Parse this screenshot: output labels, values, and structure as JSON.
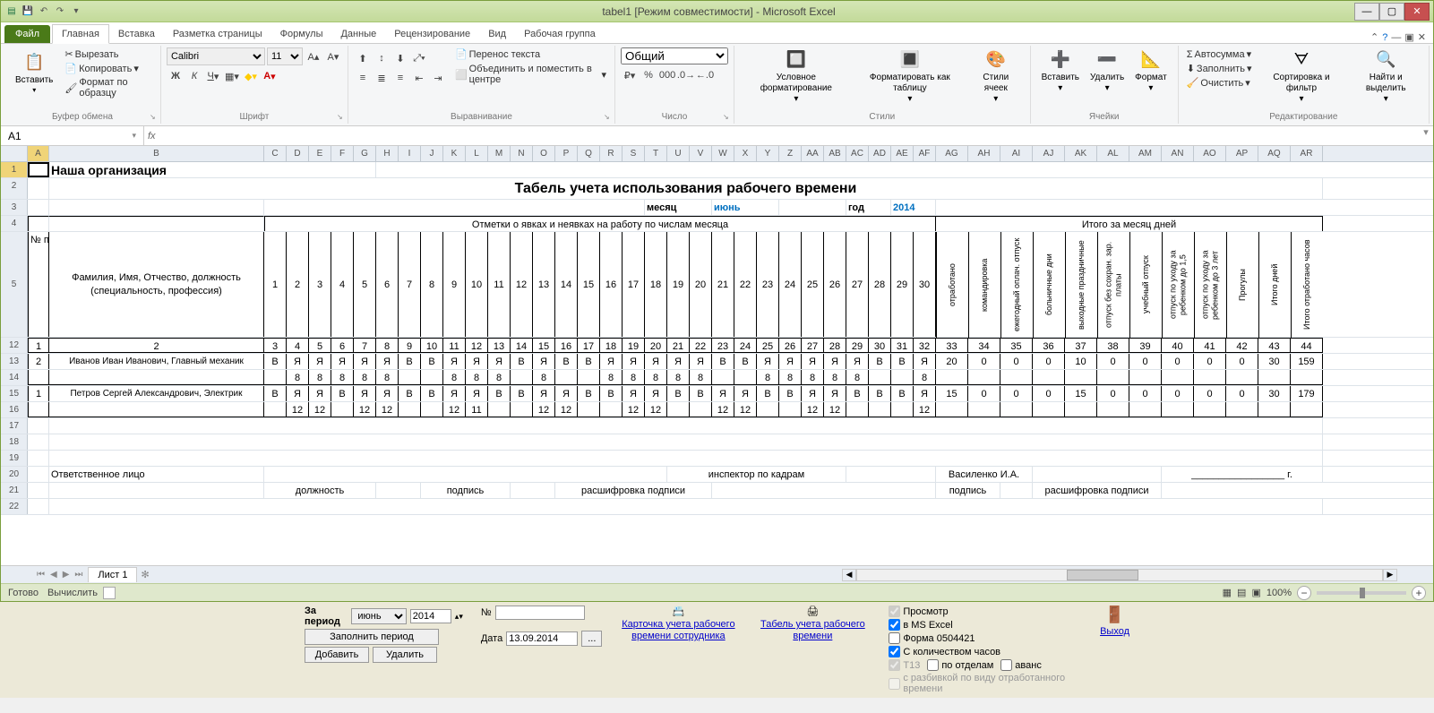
{
  "app": {
    "title": "tabel1 [Режим совместимости] - Microsoft Excel"
  },
  "ribbon": {
    "file": "Файл",
    "tabs": [
      "Главная",
      "Вставка",
      "Разметка страницы",
      "Формулы",
      "Данные",
      "Рецензирование",
      "Вид",
      "Рабочая группа"
    ],
    "active_tab": "Главная",
    "clipboard": {
      "paste": "Вставить",
      "cut": "Вырезать",
      "copy": "Копировать",
      "format": "Формат по образцу",
      "label": "Буфер обмена"
    },
    "font": {
      "name": "Calibri",
      "size": "11",
      "label": "Шрифт"
    },
    "align": {
      "wrap": "Перенос текста",
      "merge": "Объединить и поместить в центре",
      "label": "Выравнивание"
    },
    "number": {
      "format": "Общий",
      "label": "Число"
    },
    "styles": {
      "cond": "Условное форматирование",
      "table": "Форматировать как таблицу",
      "cell": "Стили ячеек",
      "label": "Стили"
    },
    "cells": {
      "insert": "Вставить",
      "delete": "Удалить",
      "format": "Формат",
      "label": "Ячейки"
    },
    "editing": {
      "autosum": "Автосумма",
      "fill": "Заполнить",
      "clear": "Очистить",
      "sort": "Сортировка и фильтр",
      "find": "Найти и выделить",
      "label": "Редактирование"
    }
  },
  "namebox": {
    "ref": "A1"
  },
  "status": {
    "ready": "Готово",
    "calc": "Вычислить",
    "zoom": "100%"
  },
  "sheet": {
    "tabname": "Лист 1",
    "cols": [
      "A",
      "B",
      "C",
      "D",
      "E",
      "F",
      "G",
      "H",
      "I",
      "J",
      "K",
      "L",
      "M",
      "N",
      "O",
      "P",
      "Q",
      "R",
      "S",
      "T",
      "U",
      "V",
      "W",
      "X",
      "Y",
      "Z",
      "AA",
      "AB",
      "AC",
      "AD",
      "AE",
      "AF",
      "AG",
      "AH",
      "AI",
      "AJ",
      "AK",
      "AL",
      "AM",
      "AN",
      "AO",
      "AP",
      "AQ",
      "AR"
    ],
    "org": "Наша организация",
    "title": "Табель учета использования рабочего времени",
    "month_label": "месяц",
    "month": "июнь",
    "year_label": "год",
    "year": "2014",
    "hdr_marks": "Отметки о явках и неявках на работу по числам месяца",
    "hdr_total": "Итого за месяц дней",
    "hdr_num": "№ п/п",
    "hdr_fio": "Фамилия, Имя, Отчество, должность (специальность, профессия)",
    "days": [
      "1",
      "2",
      "3",
      "4",
      "5",
      "6",
      "7",
      "8",
      "9",
      "10",
      "11",
      "12",
      "13",
      "14",
      "15",
      "16",
      "17",
      "18",
      "19",
      "20",
      "21",
      "22",
      "23",
      "24",
      "25",
      "26",
      "27",
      "28",
      "29",
      "30"
    ],
    "totals_hdrs": [
      "отработано",
      "командировка",
      "ежегодный оплач. отпуск",
      "больничные дни",
      "выходные праздничные",
      "отпуск без сохран. зар. платы",
      "учебный отпуск",
      "отпуск по уходу за ребенком до 1,5",
      "отпуск по уходу за ребенком до 3 лет",
      "Прогулы",
      "Итого дней",
      "Итого отработано часов"
    ],
    "numrow": [
      "1",
      "2",
      "3",
      "4",
      "5",
      "6",
      "7",
      "8",
      "9",
      "10",
      "11",
      "12",
      "13",
      "14",
      "15",
      "16",
      "17",
      "18",
      "19",
      "20",
      "21",
      "22",
      "23",
      "24",
      "25",
      "26",
      "27",
      "28",
      "29",
      "30",
      "31",
      "32",
      "33",
      "34",
      "35",
      "36",
      "37",
      "38",
      "39",
      "40",
      "41",
      "42",
      "43",
      "44"
    ],
    "rows": [
      {
        "n": "2",
        "fio": "Иванов Иван Иванович, Главный механик",
        "d1": [
          "В",
          "Я",
          "Я",
          "Я",
          "Я",
          "Я",
          "В",
          "В",
          "Я",
          "Я",
          "Я",
          "В",
          "Я",
          "В",
          "В",
          "Я",
          "Я",
          "Я",
          "Я",
          "Я",
          "В",
          "В",
          "Я",
          "Я",
          "Я",
          "Я",
          "Я",
          "В",
          "В",
          "Я"
        ],
        "d2": [
          "",
          "8",
          "8",
          "8",
          "8",
          "8",
          "",
          "",
          "8",
          "8",
          "8",
          "",
          "8",
          "",
          "",
          "8",
          "8",
          "8",
          "8",
          "8",
          "",
          "",
          "8",
          "8",
          "8",
          "8",
          "8",
          "",
          "",
          "8"
        ],
        "tot": [
          "20",
          "0",
          "0",
          "0",
          "10",
          "0",
          "0",
          "0",
          "0",
          "0",
          "30",
          "159"
        ]
      },
      {
        "n": "1",
        "fio": "Петров Сергей Александрович, Электрик",
        "d1": [
          "В",
          "Я",
          "Я",
          "В",
          "Я",
          "Я",
          "В",
          "В",
          "Я",
          "Я",
          "В",
          "В",
          "Я",
          "Я",
          "В",
          "В",
          "Я",
          "Я",
          "В",
          "В",
          "Я",
          "Я",
          "В",
          "В",
          "Я",
          "Я",
          "В",
          "В",
          "В",
          "Я"
        ],
        "d2": [
          "",
          "12",
          "12",
          "",
          "12",
          "12",
          "",
          "",
          "12",
          "11",
          "",
          "",
          "12",
          "12",
          "",
          "",
          "12",
          "12",
          "",
          "",
          "12",
          "12",
          "",
          "",
          "12",
          "12",
          "",
          "",
          "",
          "12"
        ],
        "tot": [
          "15",
          "0",
          "0",
          "0",
          "15",
          "0",
          "0",
          "0",
          "0",
          "0",
          "30",
          "179"
        ]
      }
    ],
    "footer": {
      "resp": "Ответственное лицо",
      "pos": "должность",
      "sign": "подпись",
      "decode": "расшифровка подписи",
      "insp": "инспектор по кадрам",
      "insp_name": "Василенко И.А.",
      "date_end": "г."
    }
  },
  "under": {
    "period": "За период",
    "month": "июнь",
    "year": "2014",
    "fillperiod": "Заполнить период",
    "add": "Добавить",
    "del": "Удалить",
    "num": "№",
    "date": "Дата",
    "datev": "13.09.2014",
    "card": "Карточка учета рабочего времени сотрудника",
    "tabel": "Табель учета рабочего времени",
    "preview": "Просмотр",
    "excel": "в MS Excel",
    "form": "Форма 0504421",
    "hours": "С количеством часов",
    "t13": "Т13",
    "byDept": "по отделам",
    "avans": "аванс",
    "breakdown": "с разбивкой по виду отработанного времени",
    "exit": "Выход"
  }
}
